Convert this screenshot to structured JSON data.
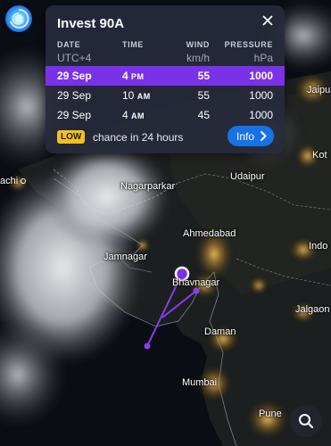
{
  "panel": {
    "title": "Invest 90A",
    "headers": {
      "date": "DATE",
      "time": "TIME",
      "wind": "WIND",
      "pressure": "PRESSURE"
    },
    "units": {
      "date": "UTC+4",
      "wind": "km/h",
      "pressure": "hPa"
    },
    "rows": [
      {
        "date": "29 Sep",
        "hour": "4",
        "ampm": "PM",
        "wind": "55",
        "pressure": "1000",
        "selected": true
      },
      {
        "date": "29 Sep",
        "hour": "10",
        "ampm": "AM",
        "wind": "55",
        "pressure": "1000",
        "selected": false
      },
      {
        "date": "29 Sep",
        "hour": "4",
        "ampm": "AM",
        "wind": "45",
        "pressure": "1000",
        "selected": false
      }
    ],
    "badge": "LOW",
    "chance": "chance in 24 hours",
    "info_label": "Info"
  },
  "places": {
    "karachi": "achi",
    "nagarparkar": "Nagarparkar",
    "udaipur": "Udaipur",
    "jaipur": "Jaipu",
    "kota": "Kot",
    "ahmedabad": "Ahmedabad",
    "indore": "Indo",
    "jamnagar": "Jamnagar",
    "bhavnagar": "Bhavnagar",
    "jalgaon": "Jalgaon",
    "daman": "Daman",
    "mumbai": "Mumbai",
    "pune": "Pune"
  },
  "colors": {
    "accent": "#7a32e8",
    "track": "#8a3cf0",
    "badge": "#f2c21a",
    "info_button": "#1672e6",
    "panel_bg": "#262a3a"
  },
  "icons": {
    "logo": "windy-logo-icon",
    "close": "close-icon",
    "info_arrow": "chevron-right-icon",
    "search": "search-icon"
  }
}
